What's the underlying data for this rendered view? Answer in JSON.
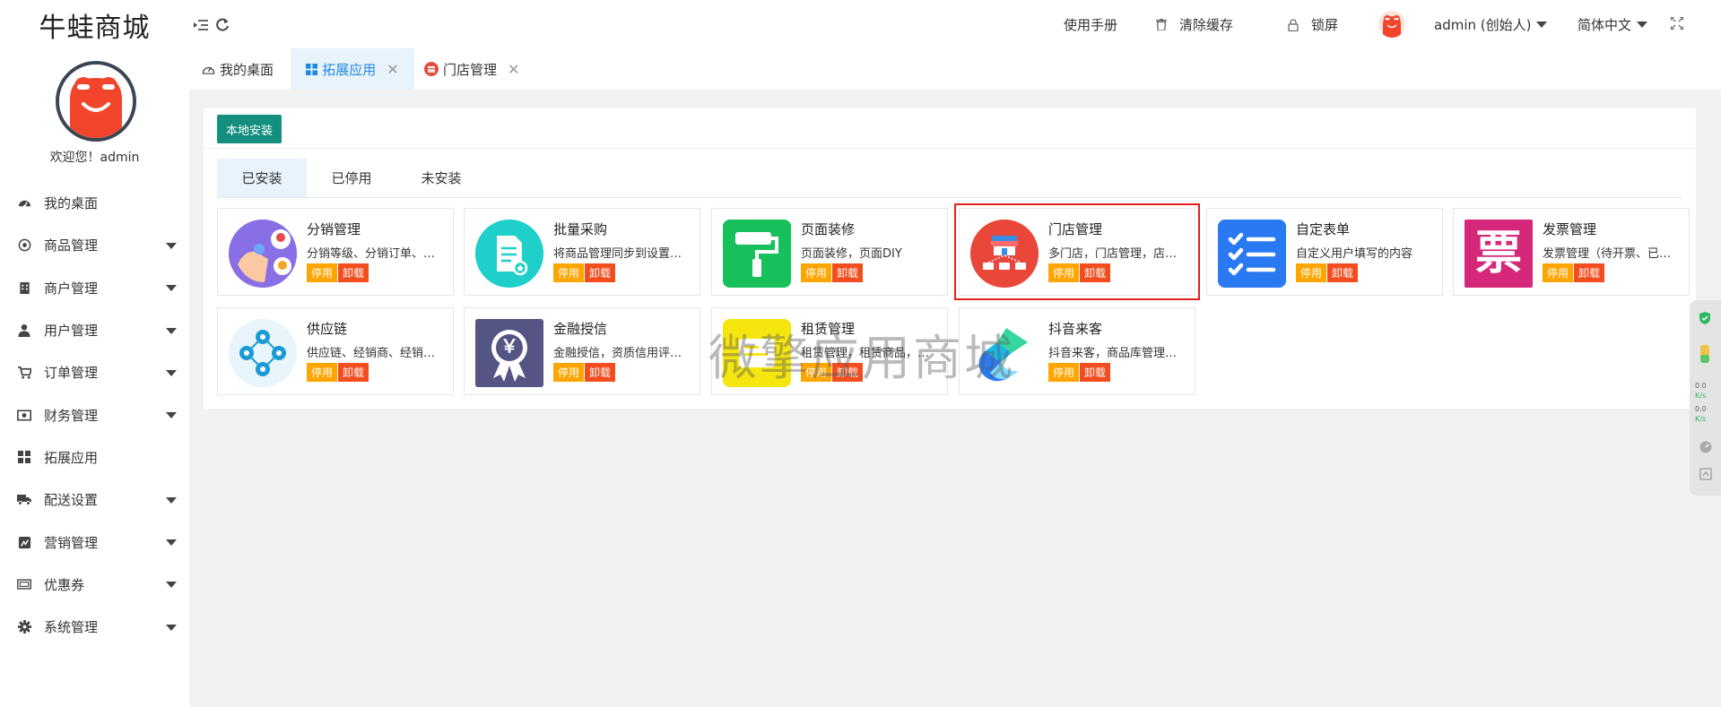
{
  "sidebar": {
    "logo": "牛蛙商城",
    "welcome": "欢迎您！admin",
    "items": [
      {
        "label": "我的桌面",
        "icon": "dashboard-icon",
        "has_submenu": false
      },
      {
        "label": "商品管理",
        "icon": "goods-icon",
        "has_submenu": true
      },
      {
        "label": "商户管理",
        "icon": "merchant-icon",
        "has_submenu": true
      },
      {
        "label": "用户管理",
        "icon": "user-icon",
        "has_submenu": true
      },
      {
        "label": "订单管理",
        "icon": "cart-icon",
        "has_submenu": true
      },
      {
        "label": "财务管理",
        "icon": "money-icon",
        "has_submenu": true
      },
      {
        "label": "拓展应用",
        "icon": "grid-icon",
        "has_submenu": false
      },
      {
        "label": "配送设置",
        "icon": "truck-icon",
        "has_submenu": true
      },
      {
        "label": "营销管理",
        "icon": "marketing-icon",
        "has_submenu": true
      },
      {
        "label": "优惠券",
        "icon": "coupon-icon",
        "has_submenu": true
      },
      {
        "label": "系统管理",
        "icon": "gear-icon",
        "has_submenu": true
      }
    ]
  },
  "header": {
    "manual": "使用手册",
    "clear_cache": "清除缓存",
    "lock": "锁屏",
    "user": "admin (创始人)",
    "language": "简体中文"
  },
  "tabs": [
    {
      "label": "我的桌面",
      "icon": "gauge-icon",
      "closable": false,
      "active": false
    },
    {
      "label": "拓展应用",
      "icon": "grid-icon",
      "closable": true,
      "active": true
    },
    {
      "label": "门店管理",
      "icon": "store-icon",
      "closable": true,
      "active": false
    }
  ],
  "main": {
    "install_button": "本地安装",
    "subtabs": [
      "已安装",
      "已停用",
      "未安装"
    ],
    "active_subtab": 0,
    "apps": [
      {
        "title": "分销管理",
        "desc": "分销等级、分销订单、分销员管理",
        "stop": "停用",
        "uninstall": "卸载"
      },
      {
        "title": "批量采购",
        "desc": "将商品管理同步到设置批量采购",
        "stop": "停用",
        "uninstall": "卸载"
      },
      {
        "title": "页面装修",
        "desc": "页面装修，页面DIY",
        "stop": "停用",
        "uninstall": "卸载"
      },
      {
        "title": "门店管理",
        "desc": "多门店，门店管理，店员管理",
        "stop": "停用",
        "uninstall": "卸载"
      },
      {
        "title": "自定表单",
        "desc": "自定义用户填写的内容",
        "stop": "停用",
        "uninstall": "卸载"
      },
      {
        "title": "发票管理",
        "desc": "发票管理（待开票、已开票）",
        "stop": "停用",
        "uninstall": "卸载"
      },
      {
        "title": "供应链",
        "desc": "供应链、经销商、经销商管理",
        "stop": "停用",
        "uninstall": "卸载"
      },
      {
        "title": "金融授信",
        "desc": "金融授信，资质信用评估管理",
        "stop": "停用",
        "uninstall": "卸载"
      },
      {
        "title": "租赁管理",
        "desc": "租赁管理，租赁商品，租赁订单",
        "stop": "停用",
        "uninstall": "卸载"
      },
      {
        "title": "抖音来客",
        "desc": "抖音来客，商品库管理，订单",
        "stop": "停用",
        "uninstall": "卸载"
      }
    ],
    "invoice_glyph": "票",
    "yen_glyph": "￥"
  },
  "watermark": "微擎应用商城",
  "float_widget": {
    "up": "0.0",
    "down": "0.0",
    "unit": "K/s"
  },
  "colors": {
    "accent": "#1e88e5",
    "install_btn": "#138f80",
    "stop_btn": "#ffa500",
    "uninstall_btn": "#f24d1e",
    "highlight": "#e5201c"
  }
}
